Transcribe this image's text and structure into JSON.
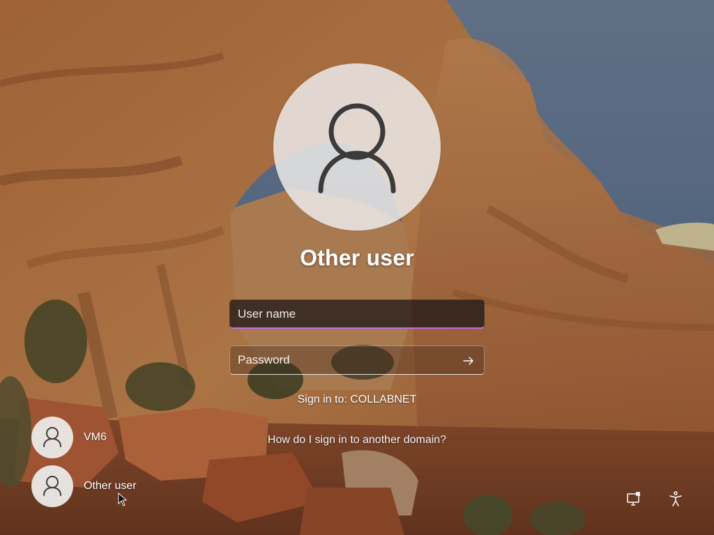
{
  "login": {
    "title": "Other user",
    "username_placeholder": "User name",
    "password_placeholder": "Password",
    "sign_in_to": "Sign in to: COLLABNET",
    "domain_help_link": "How do I sign in to another domain?"
  },
  "user_list": [
    {
      "label": "VM6",
      "icon": "user-avatar-icon"
    },
    {
      "label": "Other user",
      "icon": "user-avatar-icon"
    }
  ],
  "corner_icons": [
    "network-icon",
    "accessibility-icon"
  ],
  "colors": {
    "focus_accent": "#c06cde",
    "avatar_bg": "#ebe9e8",
    "avatar_glyph": "#3b3b3b"
  }
}
